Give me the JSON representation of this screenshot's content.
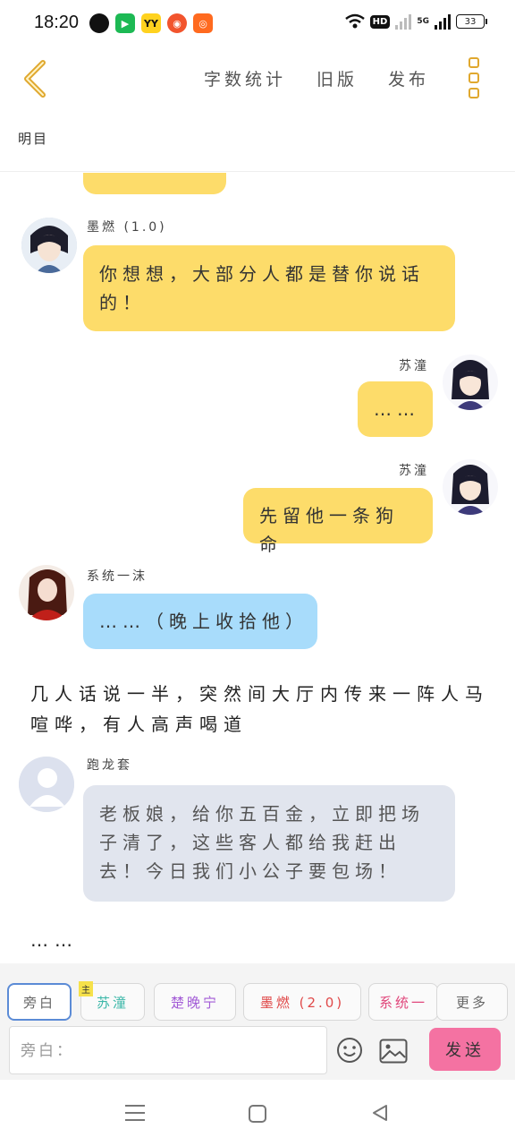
{
  "status_bar": {
    "time": "18:20",
    "network": "5G",
    "hd_label": "HD",
    "battery": "33"
  },
  "header": {
    "menu": [
      "字数统计",
      "旧版",
      "发布"
    ],
    "subtitle": "明目"
  },
  "messages": [
    {
      "id": "m0",
      "type": "bubble",
      "color": "yellow",
      "side": "left",
      "text": ""
    },
    {
      "id": "m1",
      "type": "bubble",
      "side": "left",
      "color": "yellow",
      "speaker": "墨燃 (1.0)",
      "text": "你想想，大部分人都是替你说话的！"
    },
    {
      "id": "m2",
      "type": "bubble",
      "side": "right",
      "color": "yellow",
      "speaker": "苏潼",
      "text": "……"
    },
    {
      "id": "m3",
      "type": "bubble",
      "side": "right",
      "color": "yellow",
      "speaker": "苏潼",
      "text": "先留他一条狗命"
    },
    {
      "id": "m4",
      "type": "bubble",
      "side": "left",
      "color": "blue",
      "speaker": "系统一沫",
      "text": "……（晚上收拾他）"
    },
    {
      "id": "m5",
      "type": "narration",
      "text": "几人话说一半，突然间大厅内传来一阵人马喧哗，有人高声喝道"
    },
    {
      "id": "m6",
      "type": "bubble",
      "side": "left",
      "color": "grey",
      "speaker": "跑龙套",
      "text": "老板娘，给你五百金，立即把场子清了，这些客人都给我赶出去！今日我们小公子要包场！"
    },
    {
      "id": "m7",
      "type": "narration",
      "text": "……"
    }
  ],
  "character_tabs": [
    {
      "label": "旁白",
      "active": true,
      "color": "#666666"
    },
    {
      "label": "苏潼",
      "active": false,
      "color": "#3bb7a8",
      "badge": "主"
    },
    {
      "label": "楚晚宁",
      "active": false,
      "color": "#a25bd6"
    },
    {
      "label": "墨燃 (2.0)",
      "active": false,
      "color": "#e04a4a"
    },
    {
      "label": "系统一",
      "active": false,
      "color": "#e0457a"
    },
    {
      "label": "更多",
      "active": false,
      "color": "#666666"
    }
  ],
  "input_bar": {
    "placeholder": "旁白：",
    "send_label": "发送"
  },
  "colors": {
    "accent_yellow": "#fddc6a",
    "accent_blue": "#a8dcfb",
    "send_pink": "#f472a2"
  },
  "icons": [
    "back-chevron-icon",
    "more-icon",
    "emoji-icon",
    "image-icon",
    "nav-menu-icon",
    "nav-home-icon",
    "nav-back-icon"
  ]
}
